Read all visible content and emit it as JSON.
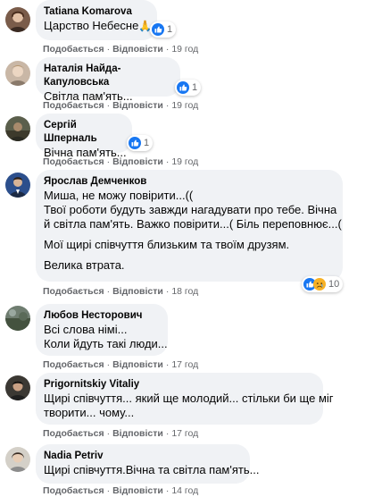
{
  "labels": {
    "like": "Подобається",
    "reply": "Відповісти",
    "dot": "·"
  },
  "comments": [
    {
      "author": "Tatiana Komarova",
      "lines": [
        "Царство Небесне"
      ],
      "emoji": "🙏",
      "reaction_count": "1",
      "time": "19 год",
      "avatar_color": "#7a5c4a"
    },
    {
      "author": "Наталія Найда-Капуловська",
      "lines": [
        "Світла пам'ять..."
      ],
      "reaction_count": "1",
      "time": "19 год",
      "avatar_color": "#c9b7a6"
    },
    {
      "author": "Сергій Шперналь",
      "lines": [
        "Вічна пам'ять..."
      ],
      "reaction_count": "1",
      "time": "19 год",
      "avatar_color": "#5b5f4c"
    },
    {
      "author": "Ярослав Демченков",
      "lines": [
        "Миша, не можу повірити...((",
        "Твої роботи будуть завжди нагадувати про тебе. Вічна",
        "й світла пам'ять. Важко повірити...( Біль переповнює...("
      ],
      "lines2": [
        "Мої щирі співчуття близьким та твоїм друзям."
      ],
      "lines3": [
        "Велика втрата."
      ],
      "reaction_count": "10",
      "time": "18 год",
      "avatar_color": "#2c4f8c"
    },
    {
      "author": "Любов Несторович",
      "lines": [
        "Всі слова німі...",
        "Коли йдуть такі люди..."
      ],
      "time": "17 год",
      "avatar_color": "#6f7d70"
    },
    {
      "author": "Prigornitskiy Vitaliy",
      "lines": [
        "Щирі співчуття... який ще молодий... стільки би ще міг",
        "творити... чому..."
      ],
      "time": "17 год",
      "avatar_color": "#3b3833"
    },
    {
      "author": "Nadia Petriv",
      "lines": [
        "Щирі співчуття.Вічна та світла пам'ять..."
      ],
      "time": "14 год",
      "avatar_color": "#d4d0c8"
    }
  ],
  "colors": {
    "like_blue": "#1877f2",
    "sad_yellow": "#f7b125",
    "bubble": "#f0f2f5",
    "meta": "#65676b"
  }
}
